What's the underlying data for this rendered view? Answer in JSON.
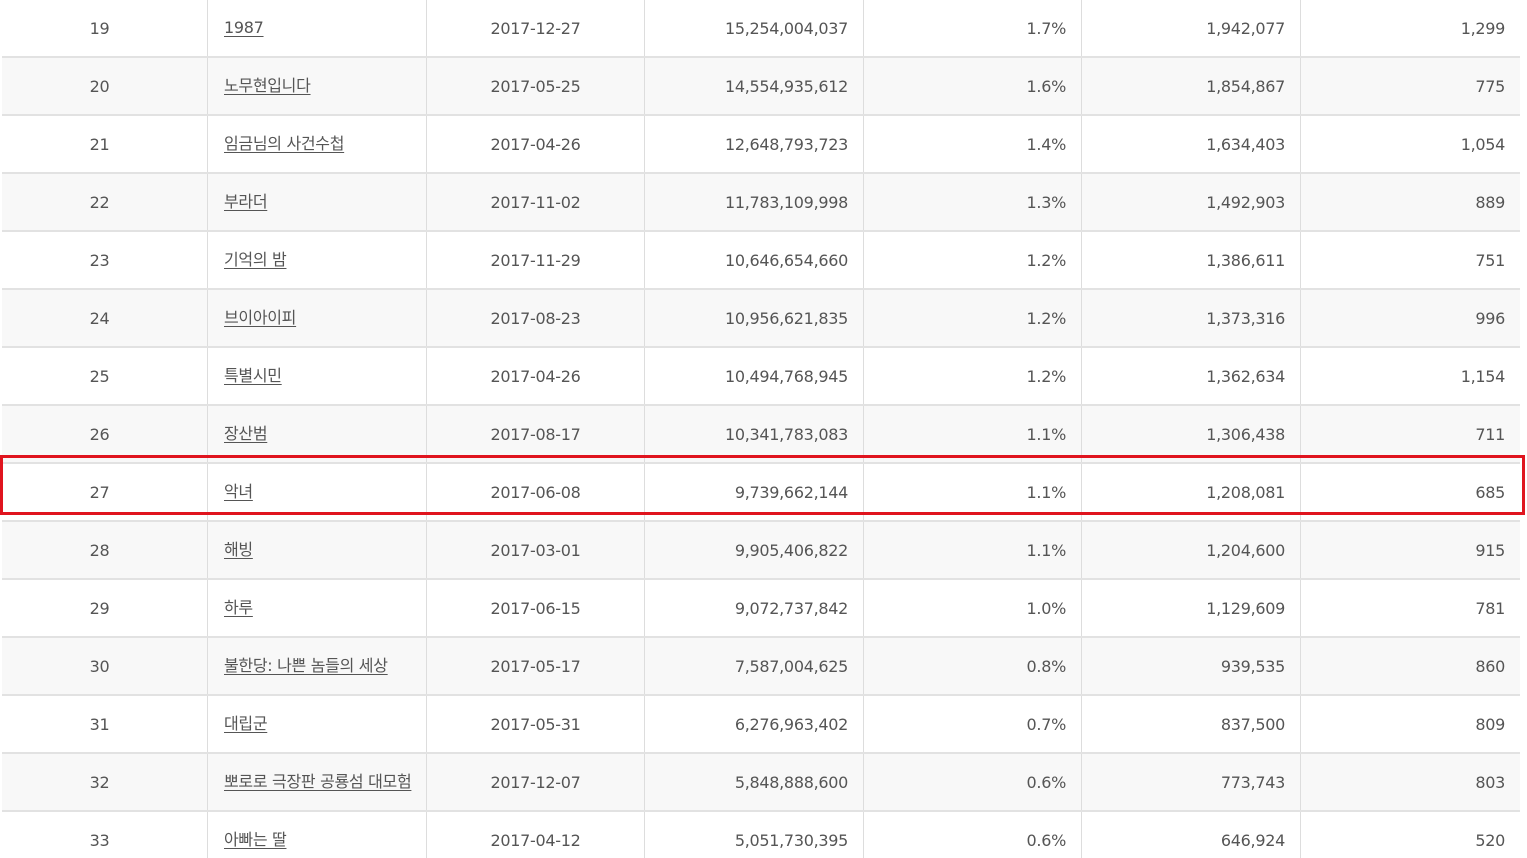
{
  "table": {
    "rows": [
      {
        "rank": "19",
        "title": "1987",
        "date": "2017-12-27",
        "sales": "15,254,004,037",
        "share": "1.7%",
        "audience": "1,942,077",
        "screens": "1,299"
      },
      {
        "rank": "20",
        "title": "노무현입니다",
        "date": "2017-05-25",
        "sales": "14,554,935,612",
        "share": "1.6%",
        "audience": "1,854,867",
        "screens": "775"
      },
      {
        "rank": "21",
        "title": "임금님의 사건수첩",
        "date": "2017-04-26",
        "sales": "12,648,793,723",
        "share": "1.4%",
        "audience": "1,634,403",
        "screens": "1,054"
      },
      {
        "rank": "22",
        "title": "부라더",
        "date": "2017-11-02",
        "sales": "11,783,109,998",
        "share": "1.3%",
        "audience": "1,492,903",
        "screens": "889"
      },
      {
        "rank": "23",
        "title": "기억의 밤",
        "date": "2017-11-29",
        "sales": "10,646,654,660",
        "share": "1.2%",
        "audience": "1,386,611",
        "screens": "751"
      },
      {
        "rank": "24",
        "title": "브이아이피",
        "date": "2017-08-23",
        "sales": "10,956,621,835",
        "share": "1.2%",
        "audience": "1,373,316",
        "screens": "996"
      },
      {
        "rank": "25",
        "title": "특별시민",
        "date": "2017-04-26",
        "sales": "10,494,768,945",
        "share": "1.2%",
        "audience": "1,362,634",
        "screens": "1,154"
      },
      {
        "rank": "26",
        "title": "장산범",
        "date": "2017-08-17",
        "sales": "10,341,783,083",
        "share": "1.1%",
        "audience": "1,306,438",
        "screens": "711"
      },
      {
        "rank": "27",
        "title": "악녀",
        "date": "2017-06-08",
        "sales": "9,739,662,144",
        "share": "1.1%",
        "audience": "1,208,081",
        "screens": "685"
      },
      {
        "rank": "28",
        "title": "해빙",
        "date": "2017-03-01",
        "sales": "9,905,406,822",
        "share": "1.1%",
        "audience": "1,204,600",
        "screens": "915"
      },
      {
        "rank": "29",
        "title": "하루",
        "date": "2017-06-15",
        "sales": "9,072,737,842",
        "share": "1.0%",
        "audience": "1,129,609",
        "screens": "781"
      },
      {
        "rank": "30",
        "title": "불한당: 나쁜 놈들의 세상",
        "date": "2017-05-17",
        "sales": "7,587,004,625",
        "share": "0.8%",
        "audience": "939,535",
        "screens": "860"
      },
      {
        "rank": "31",
        "title": "대립군",
        "date": "2017-05-31",
        "sales": "6,276,963,402",
        "share": "0.7%",
        "audience": "837,500",
        "screens": "809"
      },
      {
        "rank": "32",
        "title": "뽀로로 극장판 공룡섬 대모험",
        "date": "2017-12-07",
        "sales": "5,848,888,600",
        "share": "0.6%",
        "audience": "773,743",
        "screens": "803"
      },
      {
        "rank": "33",
        "title": "아빠는 딸",
        "date": "2017-04-12",
        "sales": "5,051,730,395",
        "share": "0.6%",
        "audience": "646,924",
        "screens": "520"
      }
    ]
  },
  "highlight": {
    "rank": "27",
    "color": "#e0141e"
  }
}
